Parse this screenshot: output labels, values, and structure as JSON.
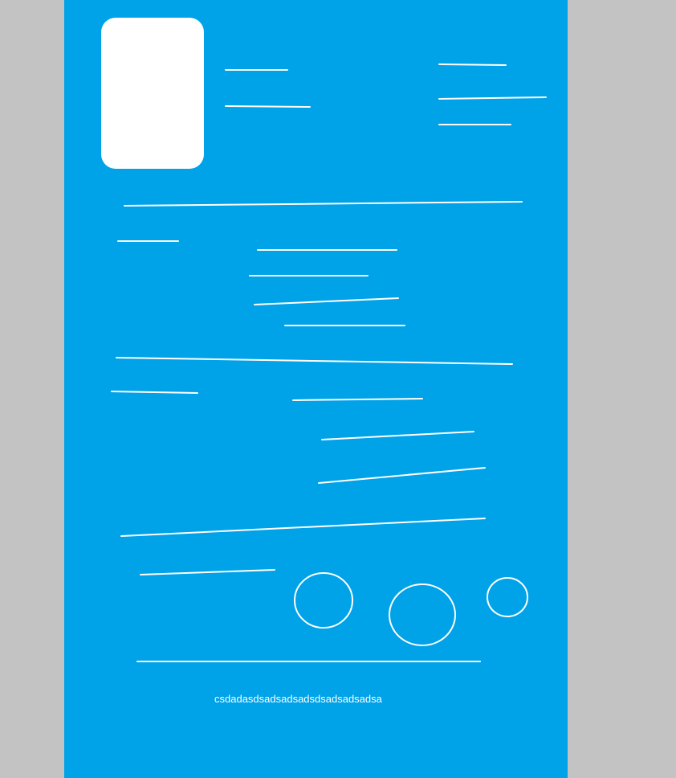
{
  "colors": {
    "background": "#c3c3c3",
    "panel": "#00a2e8",
    "ink": "#ffffff"
  },
  "caption": "csdadasdsadsadsadsdsadsadsadsa"
}
